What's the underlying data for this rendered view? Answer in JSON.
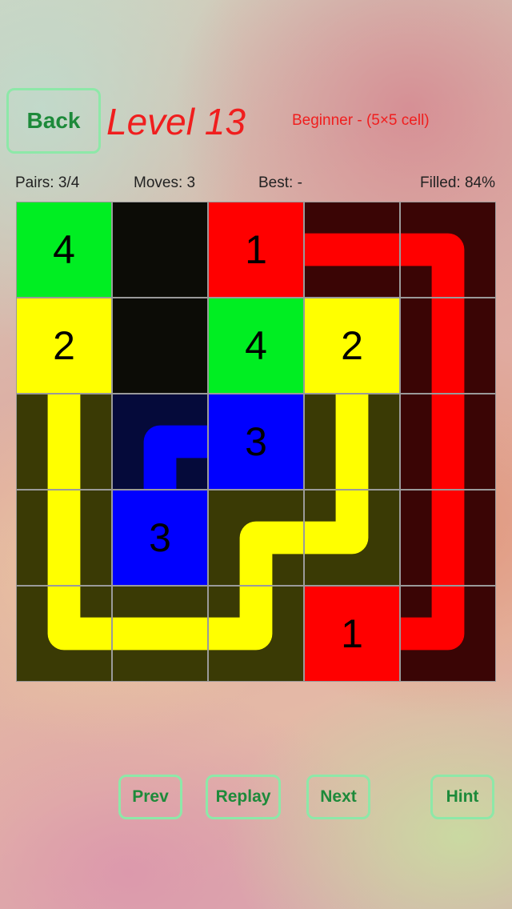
{
  "header": {
    "back_label": "Back",
    "title": "Level 13",
    "subtitle": "Beginner - (5×5 cell)"
  },
  "stats": {
    "pairs": "Pairs: 3/4",
    "moves": "Moves: 3",
    "best": "Best: -",
    "filled": "Filled: 84%"
  },
  "board": {
    "size": 5,
    "colors": {
      "1": "#ff0000",
      "2": "#ffff00",
      "3": "#0000ff",
      "4": "#00ee22"
    },
    "tints": {
      "1": "#3a0505",
      "2": "#3a3a05",
      "3": "#050a3a",
      "empty": "#0c0c06"
    },
    "endpoints": [
      {
        "row": 0,
        "col": 0,
        "label": "4"
      },
      {
        "row": 0,
        "col": 2,
        "label": "1"
      },
      {
        "row": 1,
        "col": 0,
        "label": "2"
      },
      {
        "row": 1,
        "col": 2,
        "label": "4"
      },
      {
        "row": 1,
        "col": 3,
        "label": "2"
      },
      {
        "row": 2,
        "col": 2,
        "label": "3"
      },
      {
        "row": 3,
        "col": 1,
        "label": "3"
      },
      {
        "row": 4,
        "col": 3,
        "label": "1"
      }
    ],
    "cell_fill": [
      [
        "4",
        "empty",
        "1",
        "1",
        "1"
      ],
      [
        "2",
        "empty",
        "4",
        "2",
        "1"
      ],
      [
        "2",
        "3",
        "3",
        "2",
        "1"
      ],
      [
        "2",
        "3",
        "2",
        "2",
        "1"
      ],
      [
        "2",
        "2",
        "2",
        "1",
        "1"
      ]
    ],
    "paths": [
      {
        "color": "1",
        "cells": [
          [
            0,
            2
          ],
          [
            0,
            3
          ],
          [
            0,
            4
          ],
          [
            1,
            4
          ],
          [
            2,
            4
          ],
          [
            3,
            4
          ],
          [
            4,
            4
          ],
          [
            4,
            3
          ]
        ]
      },
      {
        "color": "2",
        "cells": [
          [
            1,
            0
          ],
          [
            2,
            0
          ],
          [
            3,
            0
          ],
          [
            4,
            0
          ],
          [
            4,
            1
          ],
          [
            4,
            2
          ],
          [
            3,
            2
          ],
          [
            3,
            3
          ],
          [
            2,
            3
          ],
          [
            1,
            3
          ]
        ]
      },
      {
        "color": "3",
        "cells": [
          [
            3,
            1
          ],
          [
            2,
            1
          ],
          [
            2,
            2
          ]
        ]
      }
    ]
  },
  "controls": {
    "prev_label": "Prev",
    "replay_label": "Replay",
    "next_label": "Next",
    "hint_label": "Hint"
  }
}
